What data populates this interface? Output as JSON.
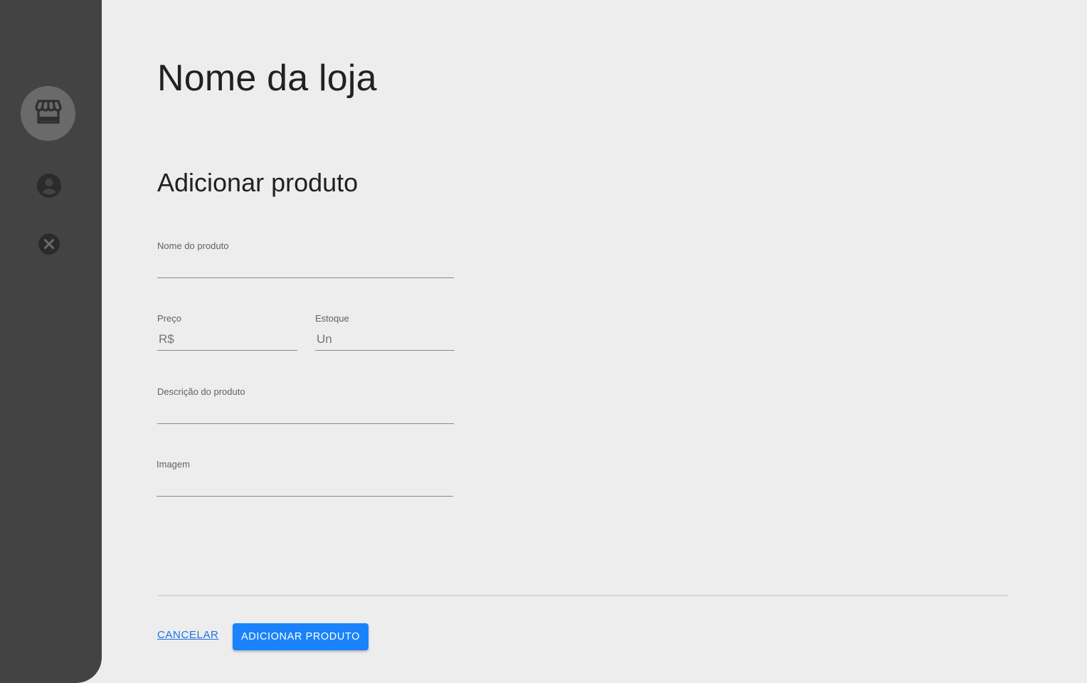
{
  "sidebar": {
    "items": [
      {
        "icon": "storefront-icon",
        "active": true
      },
      {
        "icon": "account-circle-icon",
        "active": false
      },
      {
        "icon": "close-circle-icon",
        "active": false
      }
    ]
  },
  "header": {
    "store_name": "Nome da loja"
  },
  "form": {
    "title": "Adicionar produto",
    "fields": {
      "product_name": {
        "label": "Nome do produto",
        "value": ""
      },
      "price": {
        "label": "Preço",
        "prefix": "R$",
        "value": ""
      },
      "stock": {
        "label": "Estoque",
        "prefix": "Un",
        "value": ""
      },
      "description": {
        "label": "Descrição do produto",
        "value": ""
      },
      "image": {
        "label": "Imagem",
        "value": ""
      }
    },
    "actions": {
      "cancel_label": "CANCELAR",
      "submit_label": "ADICIONAR PRODUTO"
    }
  },
  "colors": {
    "sidebar_bg": "#434343",
    "page_bg": "#ededed",
    "primary": "#1a82fb",
    "link": "#1a73e8"
  }
}
